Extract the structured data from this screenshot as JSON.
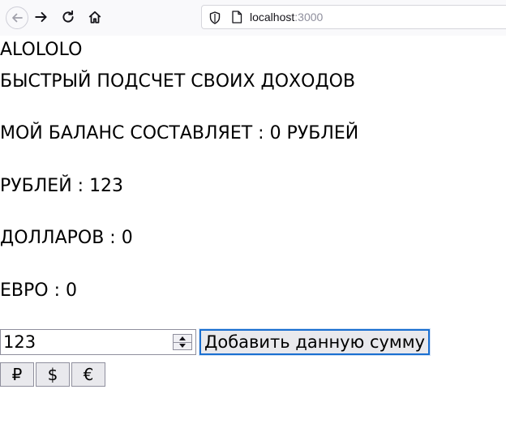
{
  "browser": {
    "url_host": "localhost",
    "url_port": ":3000"
  },
  "app": {
    "title": "ALOLOLO",
    "subtitle": "БЫСТРЫЙ ПОДСЧЕТ СВОИХ ДОХОДОВ",
    "balance_line": "МОЙ БАЛАНС СОСТАВЛЯЕТ : 0 РУБЛЕЙ",
    "rubles_line": "РУБЛЕЙ : 123",
    "dollars_line": "ДОЛЛАРОВ : 0",
    "euros_line": "ЕВРО : 0"
  },
  "form": {
    "amount_value": "123",
    "add_button_label": "Добавить данную сумму"
  },
  "currency_buttons": {
    "ruble": "₽",
    "dollar": "$",
    "euro": "€"
  },
  "colors": {
    "focus_border": "#1a6fd0",
    "button_bg": "#e9e9ed",
    "toolbar_bg": "#f9f9fb"
  }
}
